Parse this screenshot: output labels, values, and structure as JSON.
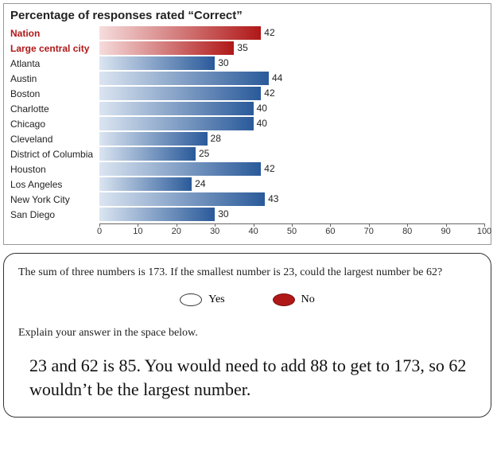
{
  "chart_data": {
    "type": "bar",
    "title": "Percentage of responses rated “Correct”",
    "xlabel": "",
    "ylabel": "",
    "xlim": [
      0,
      100
    ],
    "ticks": [
      0,
      10,
      20,
      30,
      40,
      50,
      60,
      70,
      80,
      90,
      100
    ],
    "series": [
      {
        "name": "Nation",
        "value": 42,
        "emphasis": true,
        "color": "red"
      },
      {
        "name": "Large central city",
        "value": 35,
        "emphasis": true,
        "color": "red"
      },
      {
        "name": "Atlanta",
        "value": 30,
        "emphasis": false,
        "color": "blue"
      },
      {
        "name": "Austin",
        "value": 44,
        "emphasis": false,
        "color": "blue"
      },
      {
        "name": "Boston",
        "value": 42,
        "emphasis": false,
        "color": "blue"
      },
      {
        "name": "Charlotte",
        "value": 40,
        "emphasis": false,
        "color": "blue"
      },
      {
        "name": "Chicago",
        "value": 40,
        "emphasis": false,
        "color": "blue"
      },
      {
        "name": "Cleveland",
        "value": 28,
        "emphasis": false,
        "color": "blue"
      },
      {
        "name": "District of Columbia",
        "value": 25,
        "emphasis": false,
        "color": "blue"
      },
      {
        "name": "Houston",
        "value": 42,
        "emphasis": false,
        "color": "blue"
      },
      {
        "name": "Los Angeles",
        "value": 24,
        "emphasis": false,
        "color": "blue"
      },
      {
        "name": "New York City",
        "value": 43,
        "emphasis": false,
        "color": "blue"
      },
      {
        "name": "San Diego",
        "value": 30,
        "emphasis": false,
        "color": "blue"
      }
    ]
  },
  "question": {
    "prompt": "The sum of three numbers is 173. If the smallest number is 23, could the largest number be 62?",
    "options": {
      "yes": "Yes",
      "no": "No"
    },
    "selected": "no",
    "explain_prompt": "Explain your answer in the space below.",
    "handwritten_answer": "23 and 62 is 85. You would need to add 88 to get to 173, so 62 wouldn’t be the largest number."
  }
}
